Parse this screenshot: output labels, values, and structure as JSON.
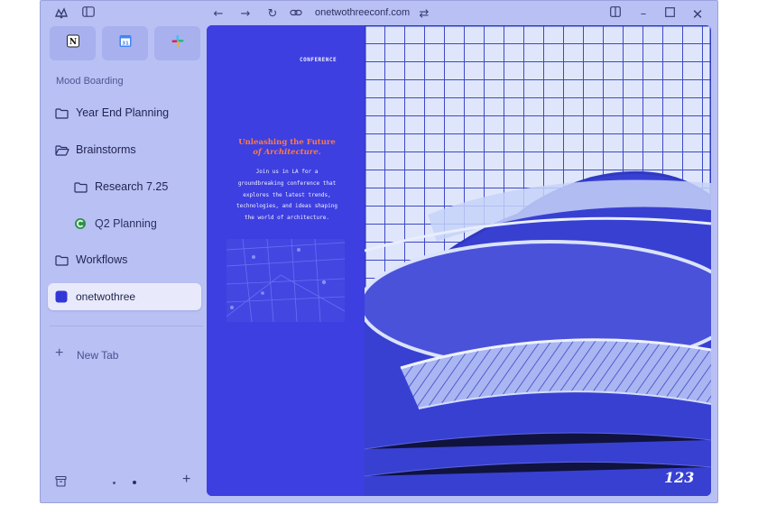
{
  "browser": {
    "url": "onetwothreeconf.com"
  },
  "sidebar": {
    "pinned": [
      {
        "name": "notion",
        "glyph": "N"
      },
      {
        "name": "google-calendar",
        "glyph": "31"
      },
      {
        "name": "slack",
        "glyph": "✳"
      }
    ],
    "section_label": "Mood Boarding",
    "items": [
      {
        "label": "Year End Planning",
        "type": "folder"
      },
      {
        "label": "Brainstorms",
        "type": "folder-open"
      },
      {
        "label": "Research 7.25",
        "type": "folder"
      },
      {
        "label": "Q2 Planning",
        "type": "app"
      },
      {
        "label": "Workflows",
        "type": "folder"
      },
      {
        "label": "onetwothree",
        "type": "tab",
        "active": true
      }
    ],
    "new_tab_label": "New Tab"
  },
  "page": {
    "conference_label": "CONFERENCE",
    "headline_line1": "Unleashing the Future",
    "headline_line2": "of Architecture.",
    "body_lines": [
      "Join us in LA for a",
      "groundbreaking conference that",
      "explores the latest trends,",
      "technologies, and ideas shaping",
      "the world of architecture."
    ],
    "logo": "123"
  },
  "colors": {
    "window_bg": "#b9c0f4",
    "poster_blue": "#3d3fe0",
    "accent_orange": "#ff7a45",
    "arrow_red": "#e8323a"
  }
}
